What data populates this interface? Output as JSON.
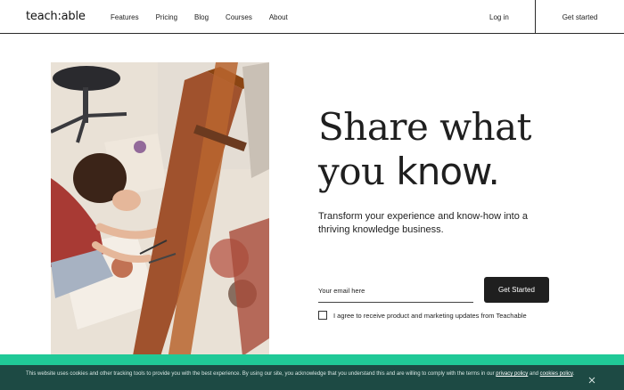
{
  "header": {
    "logo": "teach:able",
    "nav": [
      "Features",
      "Pricing",
      "Blog",
      "Courses",
      "About"
    ],
    "login": "Log in",
    "cta": "Get started"
  },
  "hero": {
    "headline_line1": "Share what",
    "headline_line2_light": "you ",
    "headline_line2_strong": "know.",
    "subtext": "Transform your experience and know-how into a thriving knowledge business.",
    "email_placeholder": "Your email here",
    "submit_label": "Get Started",
    "consent_label": "I agree to receive product and marketing updates from Teachable"
  },
  "cookie_banner": {
    "text_before": "This website uses cookies and other tracking tools to provide you with the best experience. By using our site, you acknowledge that you understand this and are willing to comply with the terms in our ",
    "privacy_link": "privacy policy",
    "text_mid": " and ",
    "cookies_link": "cookies policy",
    "text_end": "."
  },
  "icons": {
    "close": "close-icon",
    "checkbox": "checkbox-icon"
  },
  "colors": {
    "accent_green": "#20c997",
    "banner_bg": "#1d4a44",
    "button_dark": "#1f1f1f"
  }
}
